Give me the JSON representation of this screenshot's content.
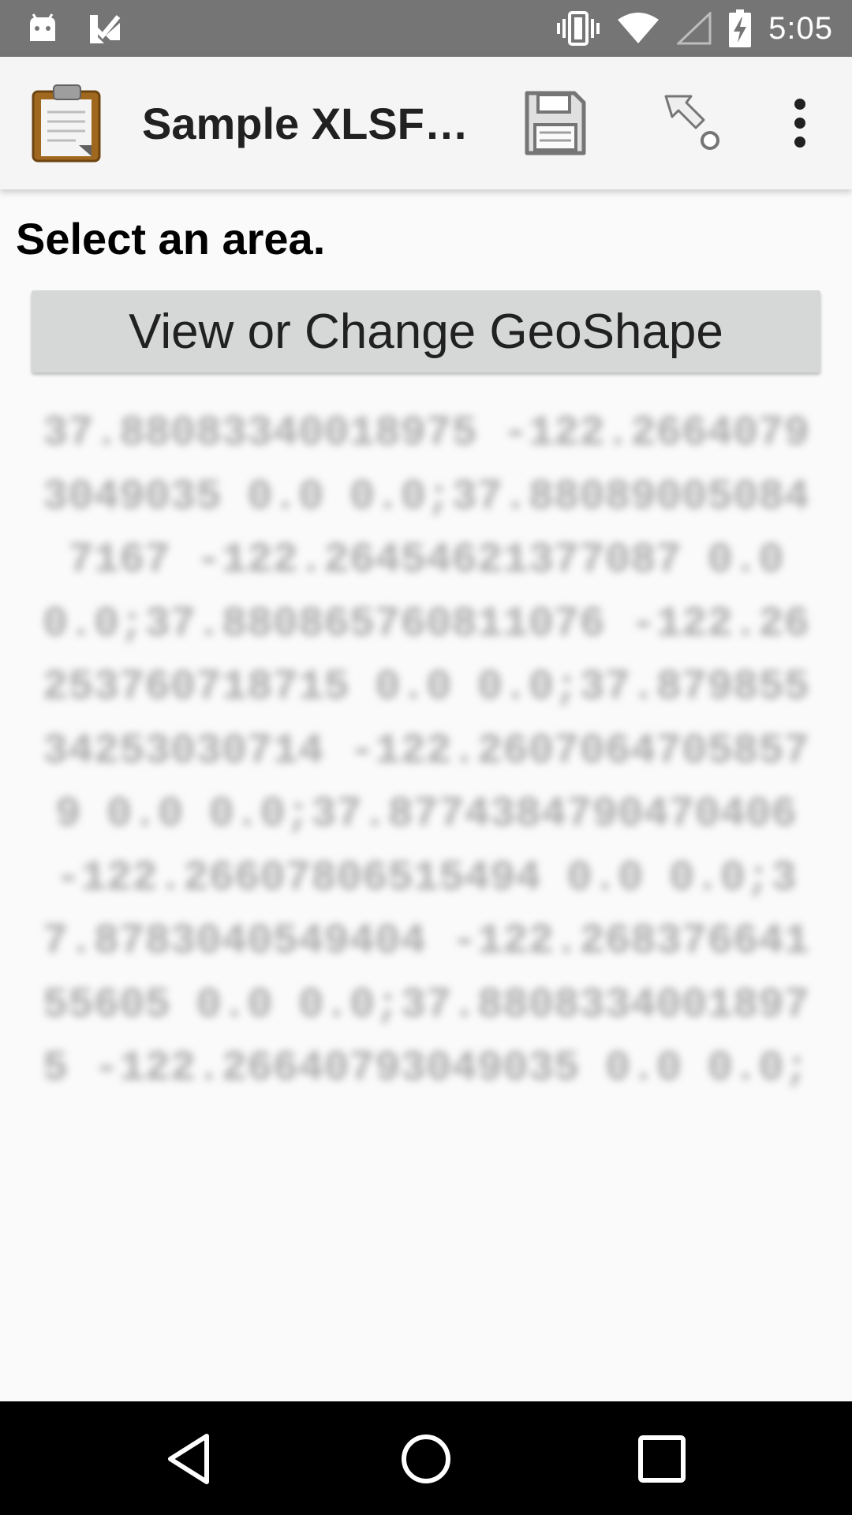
{
  "status_bar": {
    "time": "5:05",
    "icons": [
      "android-debug-icon",
      "task-check-icon",
      "vibrate-icon",
      "wifi-icon",
      "cell-signal-icon",
      "battery-charging-icon"
    ]
  },
  "app_bar": {
    "title": "Sample XLSFo…",
    "icons": [
      "clipboard-icon",
      "save-icon",
      "go-to-icon",
      "overflow-menu-icon"
    ]
  },
  "question": {
    "label": "Select an area.",
    "button_label": "View or Change GeoShape",
    "value": "37.88083340018975 -122.26640793049035 0.0 0.0;37.880890050847167 -122.26454621377087 0.0 0.0;37.880865760811076 -122.26253760718715 0.0 0.0;37.87985534253030714 -122.26070647058579 0.0 0.0;37.8774384790470406 -122.26607806515494 0.0 0.0;37.8783040549404 -122.26837664155605 0.0 0.0;37.88083340018975 -122.26640793049035 0.0 0.0;"
  },
  "nav_bar": {
    "icons": [
      "back-icon",
      "home-icon",
      "recents-icon"
    ]
  },
  "colors": {
    "status_bar": "#757575",
    "app_bar": "#f5f5f5",
    "button": "#d6d7d7",
    "background": "#fafafa",
    "nav_bar": "#000000"
  }
}
